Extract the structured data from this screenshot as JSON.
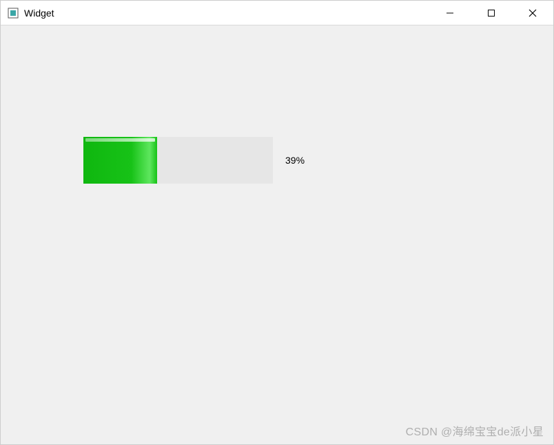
{
  "window": {
    "title": "Widget"
  },
  "progress": {
    "percent": 39,
    "percent_label": "39%"
  },
  "watermark": "CSDN @海绵宝宝de派小星"
}
